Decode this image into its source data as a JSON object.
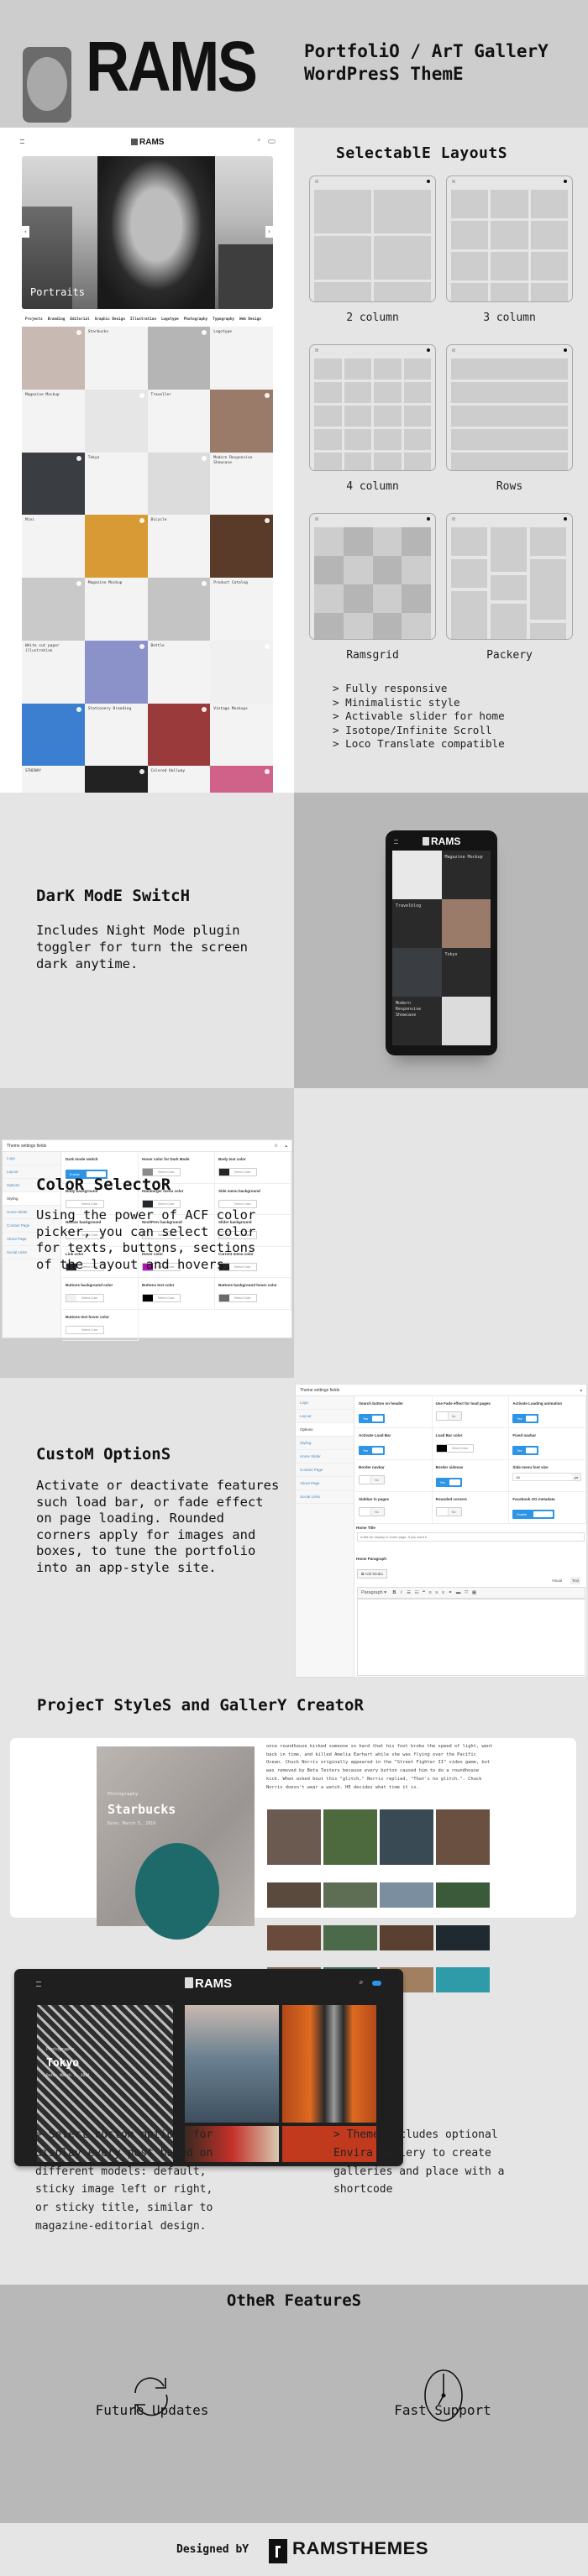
{
  "header": {
    "logo_text": "RAMS",
    "tagline_line1": "PortfoliO / ArT GallerY",
    "tagline_line2": "WordPresS ThemE"
  },
  "site_preview": {
    "logo_text": "RAMS",
    "hero_title": "Portraits",
    "categories": [
      "Projects",
      "Branding",
      "Editorial",
      "Graphic Design",
      "Illustration",
      "Logotype",
      "Photography",
      "Typography",
      "Web Design"
    ],
    "grid": [
      {
        "type": "img",
        "color": "#c8b9b3"
      },
      {
        "type": "text",
        "title": "Starbucks"
      },
      {
        "type": "img",
        "color": "#b5b5b5"
      },
      {
        "type": "text",
        "title": "Logotype"
      },
      {
        "type": "text",
        "title": "Magazine Mockup"
      },
      {
        "type": "img",
        "color": "#e6e6e6"
      },
      {
        "type": "text",
        "title": "Traveller"
      },
      {
        "type": "img",
        "color": "#9a7b6a"
      },
      {
        "type": "img",
        "color": "#3a3d42"
      },
      {
        "type": "text",
        "title": "Tokyo"
      },
      {
        "type": "img",
        "color": "#dcdcdc"
      },
      {
        "type": "text",
        "title": "Modern Responsive Showcase"
      },
      {
        "type": "text",
        "title": "Mini"
      },
      {
        "type": "img",
        "color": "#d79a35"
      },
      {
        "type": "text",
        "title": "Bicycle"
      },
      {
        "type": "img",
        "color": "#5a3b2a"
      },
      {
        "type": "img",
        "color": "#c9c9c9"
      },
      {
        "type": "text",
        "title": "Magazine Mockup"
      },
      {
        "type": "img",
        "color": "#c4c4c4"
      },
      {
        "type": "text",
        "title": "Product Catalog"
      },
      {
        "type": "text",
        "title": "White cut paper illustration"
      },
      {
        "type": "img",
        "color": "#8a92c9"
      },
      {
        "type": "text",
        "title": "Bottle"
      },
      {
        "type": "img",
        "color": "#f0f0f0"
      },
      {
        "type": "img",
        "color": "#3c7fd0"
      },
      {
        "type": "text",
        "title": "Stationery Branding"
      },
      {
        "type": "img",
        "color": "#9a3a3a"
      },
      {
        "type": "text",
        "title": "Vintage Mockups"
      },
      {
        "type": "text",
        "title": "STHENAY"
      },
      {
        "type": "img",
        "color": "#222222"
      },
      {
        "type": "text",
        "title": "Colored Hallway"
      },
      {
        "type": "img",
        "color": "#d0628a"
      }
    ]
  },
  "layouts": {
    "title": "SelectablE LayoutS",
    "items": [
      {
        "label": "2 column"
      },
      {
        "label": "3 column"
      },
      {
        "label": "4 column"
      },
      {
        "label": "Rows"
      },
      {
        "label": "Ramsgrid"
      },
      {
        "label": "Packery"
      }
    ],
    "features": [
      "> Fully responsive",
      "> Minimalistic style",
      "> Activable slider for home",
      "> Isotope/Infinite Scroll",
      "> Loco Translate compatible"
    ]
  },
  "dark_mode": {
    "title": "DarK ModE SwitcH",
    "description": "Includes Night Mode plugin toggler for turn the screen dark anytime.",
    "phone": {
      "logo_text": "RAMS",
      "cells": [
        {
          "type": "img",
          "color": "#e8e8e8"
        },
        {
          "type": "text",
          "title": "Magazine Mockup"
        },
        {
          "type": "text",
          "title": "Travelblog"
        },
        {
          "type": "img",
          "color": "#9a7b6a"
        },
        {
          "type": "img",
          "color": "#3a3d42"
        },
        {
          "type": "text",
          "title": "Tokyo"
        },
        {
          "type": "text",
          "title": "Modern Responsive Showcase"
        },
        {
          "type": "img",
          "color": "#dcdcdc"
        }
      ]
    }
  },
  "color_selector": {
    "title": "ColoR SelectoR",
    "description": "Using the power of ACF color picker, you can select color for texts, buttons, sections of the layout and hovers.",
    "panel": {
      "header": "Theme settings fields",
      "tabs": [
        "Logo",
        "Layout",
        "Options",
        "Styling",
        "Home Slider",
        "Contact Page",
        "About Page",
        "Social Links"
      ],
      "active_tab": "Styling",
      "select_color_label": "Select Color",
      "enable_label": "Enable",
      "fields": [
        {
          "label": "Dark mode switch",
          "kind": "toggle",
          "value": "Enable"
        },
        {
          "label": "Hover color for Dark Mode",
          "kind": "color",
          "color": "#8a8a8a"
        },
        {
          "label": "Body text color",
          "kind": "color",
          "color": "#23262b"
        },
        {
          "label": "Body background",
          "kind": "color",
          "color": "#ffffff"
        },
        {
          "label": "Hamburger menu color",
          "kind": "color",
          "color": "#23262b"
        },
        {
          "label": "Side menu background",
          "kind": "color",
          "color": "#ffffff"
        },
        {
          "label": "Navbar background",
          "kind": "color",
          "color": "#ffffff"
        },
        {
          "label": "Next/Prev background",
          "kind": "color",
          "color": "#f1f1f1"
        },
        {
          "label": "Slider background",
          "kind": "color",
          "color": "#f1f1f1"
        },
        {
          "label": "Link color",
          "kind": "color",
          "color": "#23262b"
        },
        {
          "label": "Hover color",
          "kind": "color",
          "color": "#b012b8"
        },
        {
          "label": "Current menu color",
          "kind": "color",
          "color": "#23262b"
        },
        {
          "label": "Buttons background color",
          "kind": "color",
          "color": "#f1f1f1"
        },
        {
          "label": "Buttons text color",
          "kind": "color",
          "color": "#000000"
        },
        {
          "label": "Buttons background hover color",
          "kind": "color",
          "color": "#6a6a6a"
        },
        {
          "label": "Buttons text hover color",
          "kind": "color",
          "color": "#ffffff"
        }
      ]
    }
  },
  "custom_options": {
    "title": "CustoM OptionS",
    "description": "Activate or deactivate features such load bar, or fade effect on page loading. Rounded corners apply for images and boxes, to tune the portfolio into an app-style site.",
    "panel": {
      "header": "Theme settings fields",
      "tabs": [
        "Logo",
        "Layout",
        "Options",
        "Styling",
        "Home Slider",
        "Contact Page",
        "About Page",
        "Social Links"
      ],
      "active_tab": "Options",
      "yes_label": "Yes",
      "no_label": "No",
      "fields": [
        {
          "label": "Search button on header",
          "kind": "toggle",
          "on": true
        },
        {
          "label": "Use Fade effect for load pages",
          "kind": "toggle",
          "on": false
        },
        {
          "label": "Activate Loading animation",
          "kind": "toggle",
          "on": true
        },
        {
          "label": "Activate Load Bar",
          "kind": "toggle",
          "on": true
        },
        {
          "label": "Load Bar color",
          "kind": "color",
          "color": "#000000"
        },
        {
          "label": "Fixed navbar",
          "kind": "toggle",
          "on": true
        },
        {
          "label": "Border navbar",
          "kind": "toggle",
          "on": false
        },
        {
          "label": "Border sidenav",
          "kind": "toggle",
          "on": true
        },
        {
          "label": "Side menu font size",
          "kind": "number",
          "value": "16",
          "unit": "px"
        },
        {
          "label": "Sidebar in pages",
          "kind": "toggle",
          "on": false
        },
        {
          "label": "Rounded corners",
          "kind": "toggle",
          "on": false
        },
        {
          "label": "Facebook OG metadata",
          "kind": "enable",
          "value": "Enable"
        }
      ],
      "home_title_label": "Home Title",
      "home_title_placeholder": "A title for display in home page, if you want it",
      "home_paragraph_label": "Home Paragraph",
      "add_media": "Add Media",
      "visual_tab": "Visual",
      "text_tab": "Text",
      "format_select": "Paragraph"
    }
  },
  "project_styles": {
    "title": "ProjecT StyleS and GallerY CreatoR",
    "starbucks": {
      "category": "Photography",
      "title": "Starbucks",
      "date": "Date: March 5, 2018"
    },
    "lorem": "once roundhouse kicked someone so hard that his foot broke the speed of light, went back in time, and killed Amelia Earhart while she was flying over the Pacific Ocean. Chuck Norris originally appeared in the \"Street Fighter II\" video game, but was removed by Beta Testers because every button caused him to do a roundhouse kick. When asked bout this \"glitch,\" Norris replied, \"That's no glitch.\". Chuck Norris doesn't wear a watch. HE decides what time it is.",
    "gallery_colors": [
      "#6b5a50",
      "#4d6a3e",
      "#3a4a55",
      "#6a5040",
      "#5a4a3e",
      "#5e6e55",
      "#7b8ea0",
      "#3b5a3a",
      "#6a4a3a",
      "#4a6a4a",
      "#5a4030",
      "#1f2a30",
      "#8a6a50",
      "#3e6e5a",
      "#a08060",
      "#2f9aa8"
    ],
    "dark_laptop": {
      "logo_text": "RAMS",
      "category": "Photography",
      "title": "Tokyo",
      "date": "Date: March 7, 2018"
    },
    "note_left": "> Select custom options for display every post based on different models: default, sticky image left or right, or sticky title, similar to magazine-editorial design.",
    "note_right": "> Theme includes optional Envira Gallery to create galleries and place with a shortcode"
  },
  "other_features": {
    "title": "OtheR FeatureS",
    "items": [
      {
        "label": "Future Updates",
        "icon": "refresh-icon"
      },
      {
        "label": "Fast Support",
        "icon": "clock-icon"
      }
    ]
  },
  "footer": {
    "designed_by": "Designed bY",
    "brand": "RAMSTHEMES"
  }
}
